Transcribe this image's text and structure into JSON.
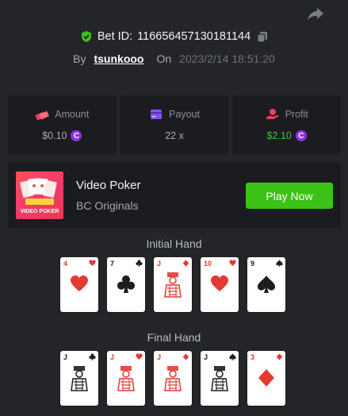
{
  "bet": {
    "label": "Bet ID:",
    "id": "116656457130181144",
    "by_label": "By",
    "user": "tsunkooo",
    "on_label": "On",
    "date": "2023/2/14 18:51:20"
  },
  "stats": {
    "amount": {
      "label": "Amount",
      "value": "$0.10"
    },
    "payout": {
      "label": "Payout",
      "value": "22 x"
    },
    "profit": {
      "label": "Profit",
      "value": "$2.10"
    }
  },
  "game": {
    "title": "Video Poker",
    "provider": "BC Originals",
    "thumb_text": "VIDEO POKER",
    "play_label": "Play Now"
  },
  "hands": {
    "initial_label": "Initial Hand",
    "final_label": "Final Hand",
    "initial": [
      {
        "rank": "4",
        "suit": "hearts",
        "color": "red"
      },
      {
        "rank": "7",
        "suit": "clubs",
        "color": "black"
      },
      {
        "rank": "J",
        "suit": "diamonds",
        "color": "red"
      },
      {
        "rank": "10",
        "suit": "hearts",
        "color": "red"
      },
      {
        "rank": "9",
        "suit": "spades",
        "color": "black"
      }
    ],
    "final": [
      {
        "rank": "J",
        "suit": "clubs",
        "color": "black"
      },
      {
        "rank": "J",
        "suit": "hearts",
        "color": "red"
      },
      {
        "rank": "J",
        "suit": "diamonds",
        "color": "red"
      },
      {
        "rank": "J",
        "suit": "spades",
        "color": "black"
      },
      {
        "rank": "3",
        "suit": "diamonds",
        "color": "red"
      }
    ]
  },
  "coin_symbol": "C",
  "colors": {
    "background": "#232528",
    "panel": "#1b1c1f",
    "accent_green": "#3bc117",
    "profit_green": "#43c542",
    "red_suit": "#e23b33",
    "coin_purple": "#8f2fe0"
  }
}
